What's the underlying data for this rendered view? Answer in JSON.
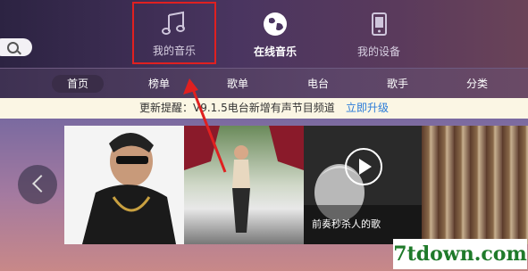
{
  "top_nav": {
    "my_music": "我的音乐",
    "online_music": "在线音乐",
    "my_device": "我的设备"
  },
  "sub_nav": [
    "首页",
    "榜单",
    "歌单",
    "电台",
    "歌手",
    "分类"
  ],
  "notice": {
    "text": "更新提醒：V9.1.5电台新增有声节目频道",
    "link": "立即升级"
  },
  "cards": [
    {
      "caption": ""
    },
    {
      "caption": ""
    },
    {
      "caption": "前奏秒杀人的歌"
    },
    {
      "caption": ""
    }
  ],
  "watermark": "7tdown.com",
  "colors": {
    "highlight_box": "#e02020",
    "link": "#2a7bd8",
    "watermark": "#1f7a2a"
  }
}
